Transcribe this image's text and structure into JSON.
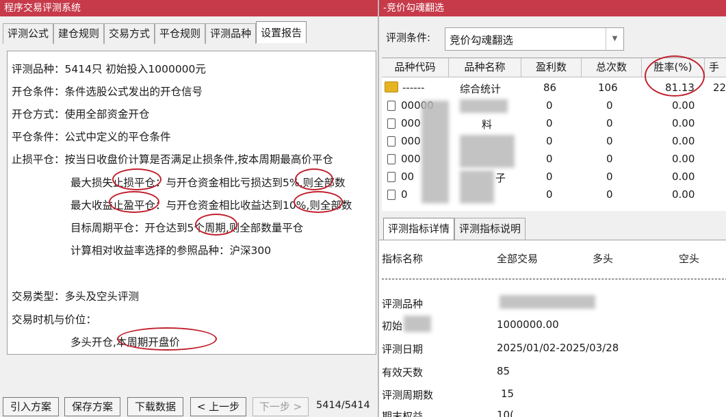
{
  "left": {
    "title": "程序交易评测系统",
    "tabs": [
      "评测公式",
      "建仓规则",
      "交易方式",
      "平仓规则",
      "评测品种",
      "设置报告"
    ],
    "active_tab": 5,
    "report": {
      "l1": "评测品种：5414只 初始投入1000000元",
      "l2": "开仓条件：条件选股公式发出的开仓信号",
      "l3": "开仓方式：使用全部资金开仓",
      "l4": "平仓条件：公式中定义的平仓条件",
      "l5": "止损平仓：按当日收盘价计算是否满足止损条件,按本周期最高价平仓",
      "l6": "最大损失止损平仓：与开仓资金相比亏损达到5%,则全部数",
      "l7": "最大收益止盈平仓：与开仓资金相比收益达到10%,则全部数",
      "l8": "目标周期平仓：开仓达到5个周期,则全部数量平仓",
      "l9": "计算相对收益率选择的参照品种：沪深300",
      "l10": "交易类型：多头及空头评测",
      "l11": "交易时机与价位：",
      "l12": "多头开仓,本周期开盘价"
    },
    "buttons": {
      "import": "引入方案",
      "save": "保存方案",
      "download": "下载数据",
      "prev": "< 上一步",
      "next": "下一步 >"
    },
    "counter": "5414/5414"
  },
  "right": {
    "title": "-竞价勾魂翻选",
    "condition_label": "评测条件:",
    "condition_value": "竞价勾魂翻选",
    "columns": [
      "品种代码",
      "品种名称",
      "盈利数",
      "总次数",
      "胜率(%)",
      "手"
    ],
    "summary_row": {
      "code": "------",
      "name": "综合统计",
      "profit": "86",
      "total": "106",
      "winrate": "81.13",
      "extra": "22"
    },
    "rows": [
      {
        "code": "00000",
        "name": "",
        "profit": "0",
        "total": "0",
        "winrate": "0.00"
      },
      {
        "code": "000",
        "name": "料",
        "profit": "0",
        "total": "0",
        "winrate": "0.00"
      },
      {
        "code": "000",
        "name": "",
        "profit": "0",
        "total": "0",
        "winrate": "0.00"
      },
      {
        "code": "000",
        "name": "",
        "profit": "0",
        "total": "0",
        "winrate": "0.00"
      },
      {
        "code": "00",
        "name": "子",
        "profit": "0",
        "total": "0",
        "winrate": "0.00"
      },
      {
        "code": "0",
        "name": "",
        "profit": "0",
        "total": "0",
        "winrate": "0.00"
      }
    ],
    "tabs": [
      "评测指标详情",
      "评测指标说明"
    ],
    "detail_header": [
      "指标名称",
      "全部交易",
      "多头",
      "空头"
    ],
    "details": [
      {
        "label": "评测品种",
        "value": ""
      },
      {
        "label": "初始",
        "value": "1000000.00"
      },
      {
        "label": "评测日期",
        "value": "2025/01/02-2025/03/28"
      },
      {
        "label": "有效天数",
        "value": "85"
      },
      {
        "label": "评测周期数",
        "value": "15"
      },
      {
        "label": "期末权益",
        "value": "10("
      }
    ]
  },
  "colors": {
    "title_bar": "#c63a4a",
    "annotation_circle": "#c0212e"
  }
}
